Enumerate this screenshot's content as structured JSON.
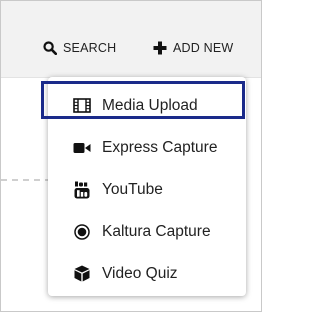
{
  "toolbar": {
    "search_label": "SEARCH",
    "add_new_label": "ADD NEW"
  },
  "menu": {
    "items": [
      {
        "label": "Media Upload",
        "icon": "film-icon"
      },
      {
        "label": "Express Capture",
        "icon": "video-camera-icon"
      },
      {
        "label": "YouTube",
        "icon": "youtube-icon"
      },
      {
        "label": "Kaltura Capture",
        "icon": "record-icon"
      },
      {
        "label": "Video Quiz",
        "icon": "cube-icon"
      }
    ],
    "focused_item": "Media Upload"
  },
  "colors": {
    "toolbar_bg": "#f2f2f2",
    "focus_ring": "#1a2a8a",
    "text": "#222222"
  }
}
